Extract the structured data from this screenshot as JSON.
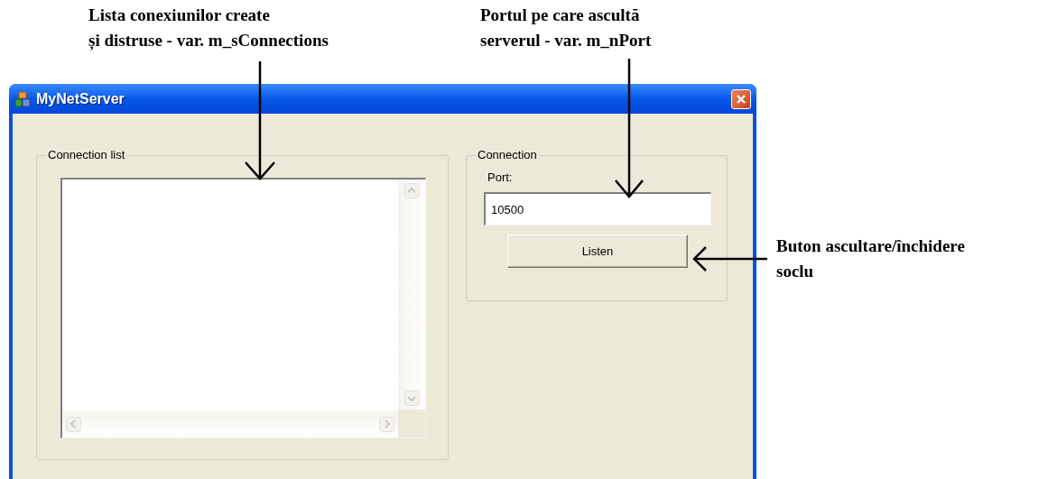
{
  "annotations": [
    {
      "lines": [
        "Lista conexiunilor create",
        "și distruse - var. m_sConnections"
      ]
    },
    {
      "lines": [
        "Portul pe care ascultă",
        "serverul - var. m_nPort"
      ]
    },
    {
      "lines": [
        "Buton ascultare/închidere",
        "soclu"
      ]
    }
  ],
  "window": {
    "title": "MyNetServer"
  },
  "connection_list": {
    "label": "Connection list"
  },
  "connection": {
    "label": "Connection",
    "port_label": "Port:",
    "port_value": "10500",
    "button": "Listen"
  }
}
